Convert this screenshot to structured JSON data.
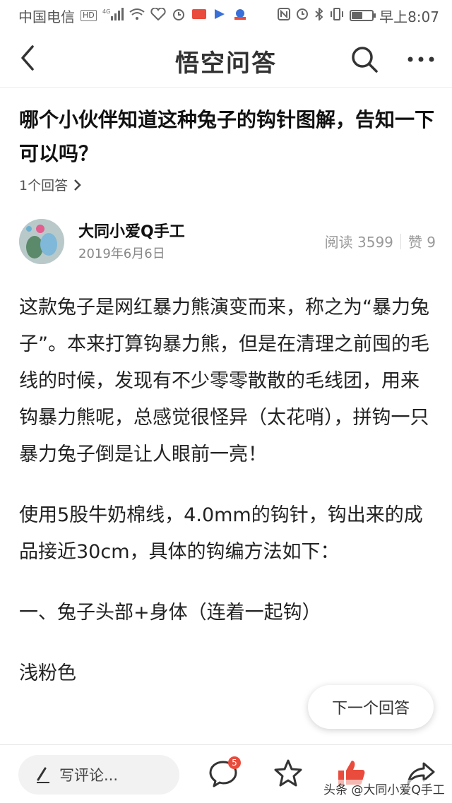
{
  "status_bar": {
    "carrier": "中国电信",
    "network_badge": "HD",
    "signal_label": "4G",
    "time": "早上8:07",
    "icons": [
      "signal-icon",
      "wifi-icon",
      "heart-icon",
      "alarm-icon",
      "app-icon",
      "nfc-icon",
      "clock-icon",
      "bluetooth-icon",
      "vibrate-icon",
      "battery-icon"
    ],
    "battery_level": 0.5
  },
  "nav": {
    "title": "悟空问答",
    "back_icon": "back-arrow-icon",
    "search_icon": "search-icon",
    "more_icon": "more-icon"
  },
  "question": {
    "title": "哪个小伙伴知道这种兔子的钩针图解，告知一下可以吗？",
    "answer_count": "1个回答"
  },
  "author": {
    "name": "大同小爱Q手工",
    "date": "2019年6月6日",
    "reads": "阅读 3599",
    "likes": "赞 9"
  },
  "content": {
    "paragraphs": [
      "这款兔子是网红暴力熊演变而来，称之为“暴力兔子”。本来打算钩暴力熊，但是在清理之前囤的毛线的时候，发现有不少零零散散的毛线团，用来钩暴力熊呢，总感觉很怪异（太花哨），拼钩一只暴力兔子倒是让人眼前一亮！",
      "使用5股牛奶棉线，4.0mm的钩针，钩出来的成品接近30cm，具体的钩编方法如下：",
      "一、兔子头部+身体（连着一起钩）",
      "浅粉色"
    ]
  },
  "next_answer": "下一个回答",
  "bottom_bar": {
    "comment_placeholder": "写评论...",
    "comment_count": "5",
    "watermark": "头条 @大同小爱Q手工"
  },
  "colors": {
    "like_red": "#e94b3c",
    "text_dark": "#222222",
    "text_muted": "#999999"
  }
}
